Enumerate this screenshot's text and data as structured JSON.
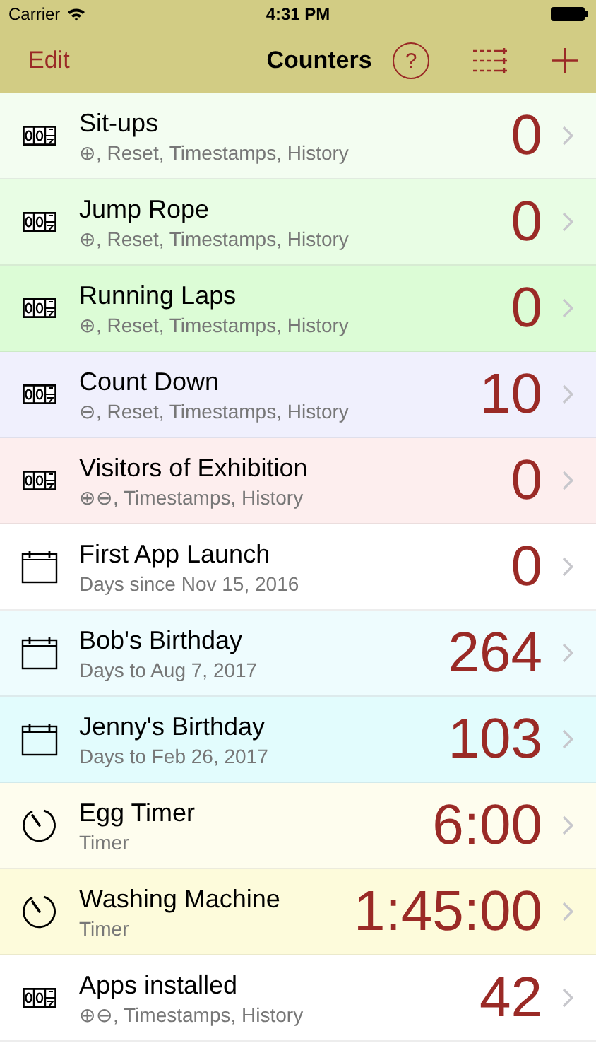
{
  "status_bar": {
    "carrier": "Carrier",
    "time": "4:31 PM"
  },
  "nav": {
    "edit": "Edit",
    "title": "Counters",
    "help": "?"
  },
  "rows": [
    {
      "kind": "counter",
      "title": "Sit-ups",
      "subtitle": "⊕, Reset, Timestamps, History",
      "value": "0",
      "color": "#f3fdf1"
    },
    {
      "kind": "counter",
      "title": "Jump Rope",
      "subtitle": "⊕, Reset, Timestamps, History",
      "value": "0",
      "color": "#e8fde4"
    },
    {
      "kind": "counter",
      "title": "Running Laps",
      "subtitle": "⊕, Reset, Timestamps, History",
      "value": "0",
      "color": "#dcfcd6"
    },
    {
      "kind": "counter",
      "title": "Count Down",
      "subtitle": "⊖, Reset, Timestamps, History",
      "value": "10",
      "color": "#f0f0fd"
    },
    {
      "kind": "counter",
      "title": "Visitors of Exhibition",
      "subtitle": "⊕⊖, Timestamps, History",
      "value": "0",
      "color": "#fdeeee"
    },
    {
      "kind": "date",
      "title": "First App Launch",
      "subtitle": "Days since Nov 15, 2016",
      "value": "0",
      "color": "#ffffff"
    },
    {
      "kind": "date",
      "title": "Bob's Birthday",
      "subtitle": "Days to Aug 7, 2017",
      "value": "264",
      "color": "#eefcfe"
    },
    {
      "kind": "date",
      "title": "Jenny's Birthday",
      "subtitle": "Days to Feb 26, 2017",
      "value": "103",
      "color": "#e2fcfd"
    },
    {
      "kind": "timer",
      "title": "Egg Timer",
      "subtitle": "Timer",
      "value": "6:00",
      "color": "#fefdee"
    },
    {
      "kind": "timer",
      "title": "Washing Machine",
      "subtitle": "Timer",
      "value": "1:45:00",
      "color": "#fdfbdb"
    },
    {
      "kind": "counter",
      "title": "Apps installed",
      "subtitle": "⊕⊖, Timestamps, History",
      "value": "42",
      "color": "#ffffff"
    }
  ]
}
